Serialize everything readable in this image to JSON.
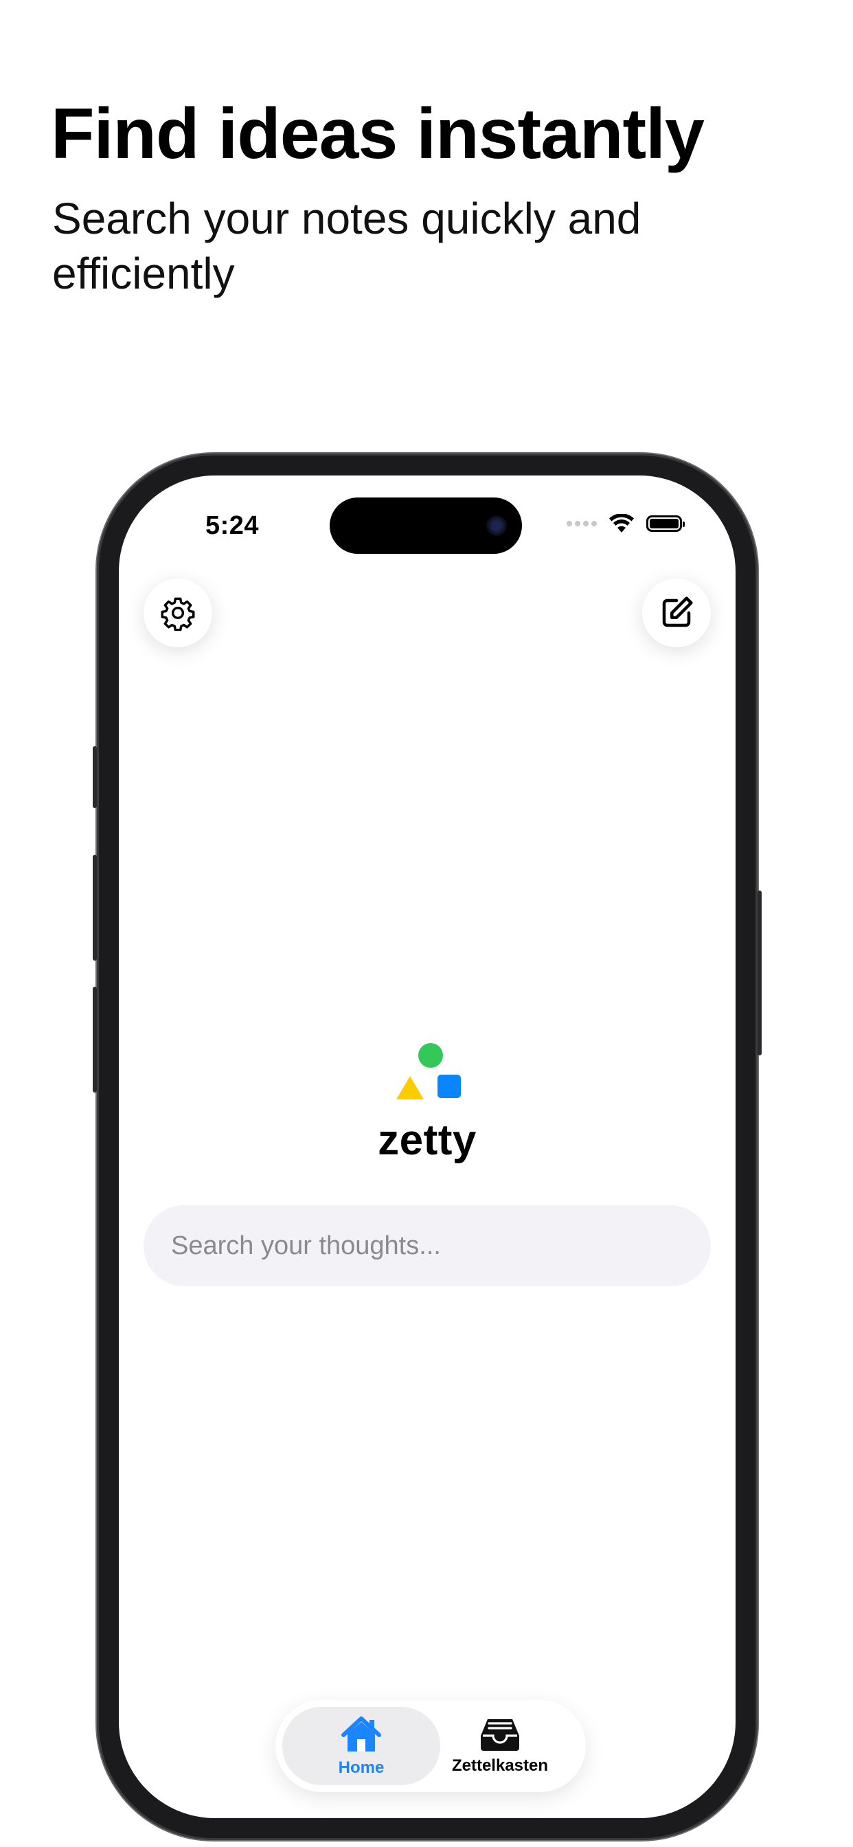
{
  "promo": {
    "headline": "Find ideas instantly",
    "subhead": "Search your notes quickly and efficiently"
  },
  "status_bar": {
    "time": "5:24"
  },
  "toolbar": {
    "settings_icon": "gear-icon",
    "compose_icon": "compose-icon"
  },
  "app": {
    "name": "zetty",
    "logo_colors": {
      "circle": "#34C759",
      "triangle": "#FFCC00",
      "square": "#0A84FF"
    }
  },
  "search": {
    "placeholder": "Search your thoughts...",
    "value": ""
  },
  "tabbar": {
    "tabs": [
      {
        "label": "Home",
        "icon": "house-icon",
        "selected": true
      },
      {
        "label": "Zettelkasten",
        "icon": "inbox-tray-icon",
        "selected": false
      }
    ]
  },
  "colors": {
    "accent": "#1A85FF",
    "search_bg": "#F2F2F7"
  }
}
